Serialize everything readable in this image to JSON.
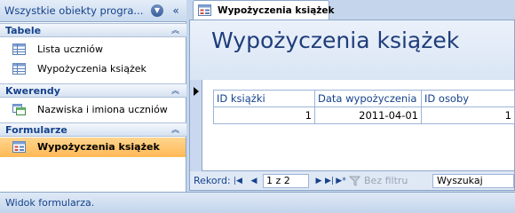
{
  "navigation_pane": {
    "title": "Wszystkie obiekty progra...",
    "dropdown_icon": "chevron-down-icon",
    "collapse_icon": "double-chevron-left-icon",
    "groups": [
      {
        "label": "Tabele",
        "items": [
          {
            "label": "Lista uczniów",
            "icon": "table-icon"
          },
          {
            "label": "Wypożyczenia książek",
            "icon": "table-icon"
          }
        ]
      },
      {
        "label": "Kwerendy",
        "items": [
          {
            "label": "Nazwiska i imiona uczniów",
            "icon": "query-icon"
          }
        ]
      },
      {
        "label": "Formularze",
        "items": [
          {
            "label": "Wypożyczenia książek",
            "icon": "form-icon",
            "selected": true
          }
        ]
      }
    ]
  },
  "document_tab": {
    "label": "Wypożyczenia książek",
    "icon": "form-icon"
  },
  "form": {
    "title": "Wypożyczenia książek",
    "columns": [
      "ID książki",
      "Data wypożyczenia",
      "ID osoby"
    ],
    "row": [
      "1",
      "2011-04-01",
      "1"
    ]
  },
  "record_navigator": {
    "label": "Rekord:",
    "position": "1 z 2",
    "filter_label": "Bez filtru",
    "search_placeholder": "Wyszukaj"
  },
  "status_bar": {
    "text": "Widok formularza."
  },
  "colors": {
    "accent": "#15428b",
    "selected_item": "#ffc46b",
    "title": "#1f3d7a"
  }
}
